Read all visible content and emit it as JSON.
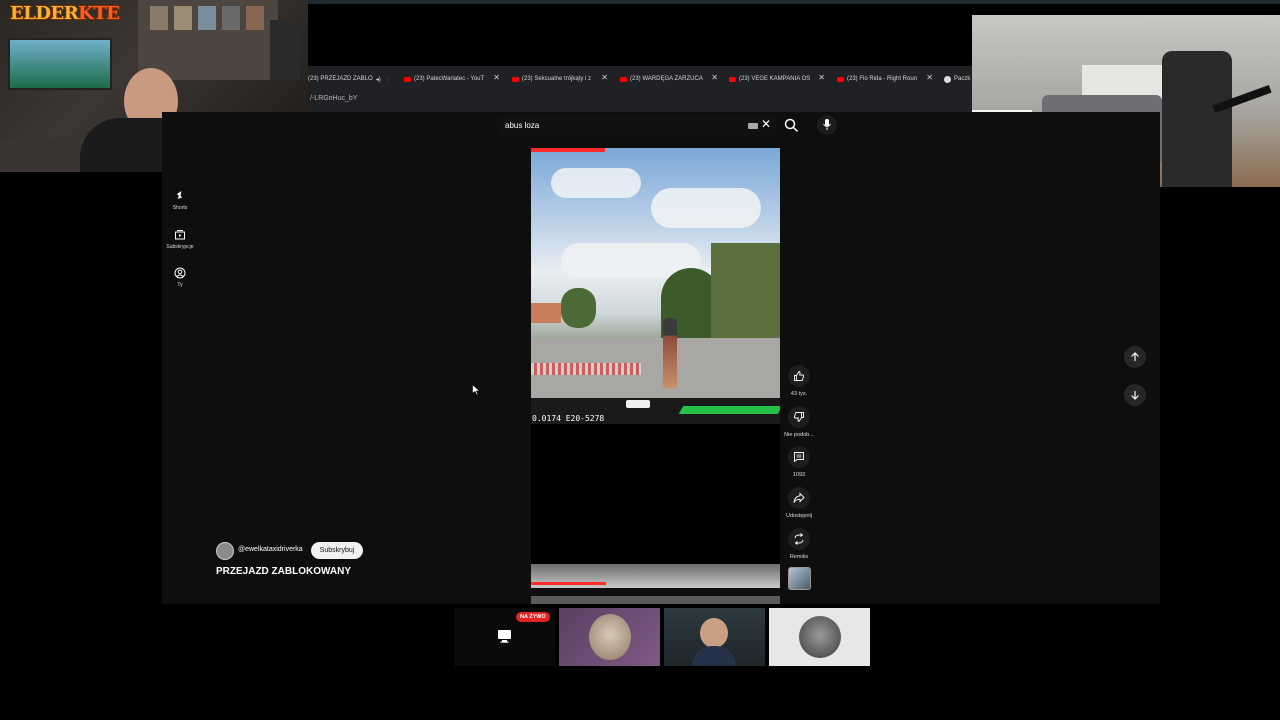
{
  "stream_logo": {
    "part1": "ELDER",
    "part2": "KTE"
  },
  "browser": {
    "tabs": [
      {
        "label": "(23) PRZEJAZD ZABLO"
      },
      {
        "label": "(23) PatecWariatec - YouT"
      },
      {
        "label": "(23) Seksualne trójkąty i z"
      },
      {
        "label": "(23) WARDĘGA ZARZUCA"
      },
      {
        "label": "(23) VEGE KAMPANIA OS"
      },
      {
        "label": "(23) Flo Rida - Right Roun"
      },
      {
        "label": "Paczk"
      }
    ],
    "url_fragment": "/-LRGnHuc_bY"
  },
  "sidebar": {
    "items": [
      {
        "label": "Shorts",
        "icon": "shorts-icon"
      },
      {
        "label": "Subskrypcje",
        "icon": "subscriptions-icon"
      },
      {
        "label": "Ty",
        "icon": "account-icon"
      }
    ]
  },
  "search": {
    "value": "abus loza",
    "icon": "search-icon",
    "mic_icon": "mic-icon"
  },
  "video": {
    "overlay_code": "0.0174 E20-5278"
  },
  "actions": [
    {
      "label": "43 tys.",
      "icon": "thumbs-up-icon"
    },
    {
      "label": "Nie podob...",
      "icon": "thumbs-down-icon"
    },
    {
      "label": "1093",
      "icon": "comment-icon"
    },
    {
      "label": "Udostępnij",
      "icon": "share-icon"
    },
    {
      "label": "Remiks",
      "icon": "remix-icon"
    }
  ],
  "channel": {
    "handle": "@ewelkataxidriverka",
    "subscribe_label": "Subskrybuj"
  },
  "short_title": "PRZEJAZD ZABLOKOWANY",
  "live_badge": "NA ŻYWO",
  "colors": {
    "accent_red": "#ff0000",
    "live_red": "#e02424",
    "background": "#000000"
  }
}
